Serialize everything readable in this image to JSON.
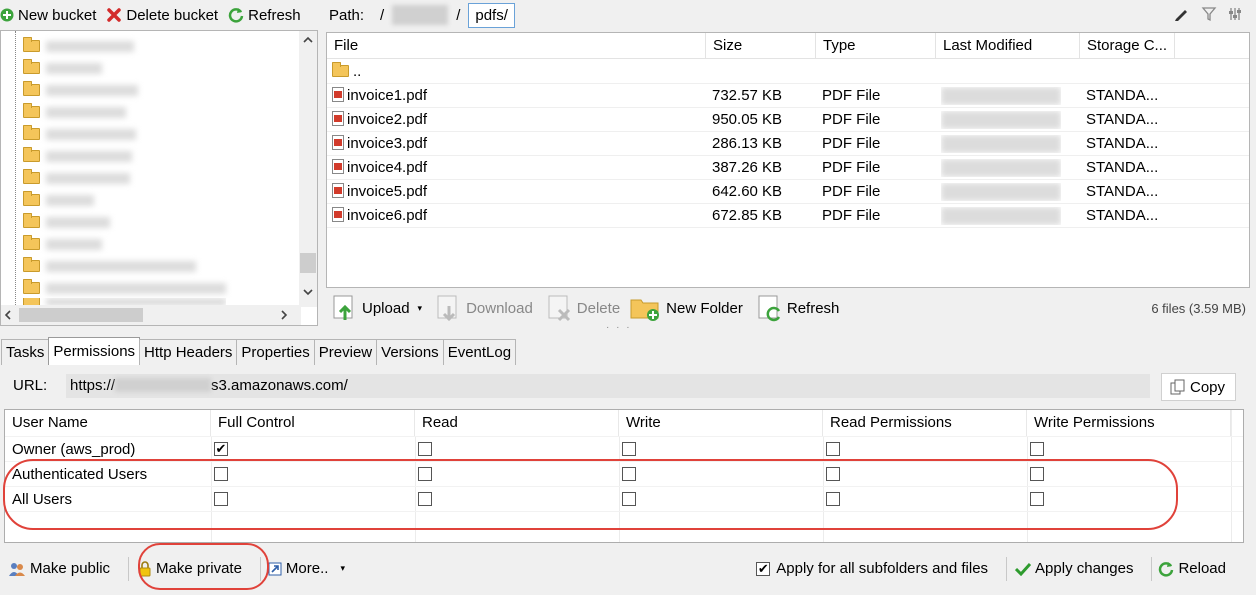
{
  "left_toolbar": {
    "new_bucket": "New bucket",
    "delete_bucket": "Delete bucket",
    "refresh": "Refresh"
  },
  "path_bar": {
    "label": "Path:",
    "root": "/",
    "separator": "/",
    "current": "pdfs/"
  },
  "file_table": {
    "columns": [
      "File",
      "Size",
      "Type",
      "Last Modified",
      "Storage C..."
    ],
    "parent_row": "..",
    "rows": [
      {
        "name": "invoice1.pdf",
        "size": "732.57 KB",
        "type": "PDF File",
        "storage": "STANDA..."
      },
      {
        "name": "invoice2.pdf",
        "size": "950.05 KB",
        "type": "PDF File",
        "storage": "STANDA..."
      },
      {
        "name": "invoice3.pdf",
        "size": "286.13 KB",
        "type": "PDF File",
        "storage": "STANDA..."
      },
      {
        "name": "invoice4.pdf",
        "size": "387.26 KB",
        "type": "PDF File",
        "storage": "STANDA..."
      },
      {
        "name": "invoice5.pdf",
        "size": "642.60 KB",
        "type": "PDF File",
        "storage": "STANDA..."
      },
      {
        "name": "invoice6.pdf",
        "size": "672.85 KB",
        "type": "PDF File",
        "storage": "STANDA..."
      }
    ]
  },
  "file_toolbar": {
    "upload": "Upload",
    "download": "Download",
    "delete": "Delete",
    "new_folder": "New Folder",
    "refresh": "Refresh",
    "status": "6 files (3.59 MB)"
  },
  "tabs": [
    "Tasks",
    "Permissions",
    "Http Headers",
    "Properties",
    "Preview",
    "Versions",
    "EventLog"
  ],
  "active_tab": "Permissions",
  "url_row": {
    "label": "URL:",
    "prefix": "https://",
    "suffix": "s3.amazonaws.com/",
    "copy": "Copy"
  },
  "permissions": {
    "columns": [
      "User Name",
      "Full Control",
      "Read",
      "Write",
      "Read Permissions",
      "Write Permissions"
    ],
    "rows": [
      {
        "name": "Owner (aws_prod)",
        "checks": [
          true,
          false,
          false,
          false,
          false
        ]
      },
      {
        "name": "Authenticated Users",
        "checks": [
          false,
          false,
          false,
          false,
          false
        ]
      },
      {
        "name": "All Users",
        "checks": [
          false,
          false,
          false,
          false,
          false
        ]
      }
    ]
  },
  "bottom_bar": {
    "make_public": "Make public",
    "make_private": "Make private",
    "more": "More..",
    "apply_all": "Apply for all subfolders and files",
    "apply_all_checked": true,
    "apply_changes": "Apply changes",
    "reload": "Reload"
  },
  "splitter_grip": "· · ·",
  "colors": {
    "annotation_red": "#e0423a",
    "selection_border": "#6aa2d8",
    "pdf_red": "#d23b2b",
    "folder_yellow": "#f4c55a",
    "check_green": "#2e9b2e"
  }
}
